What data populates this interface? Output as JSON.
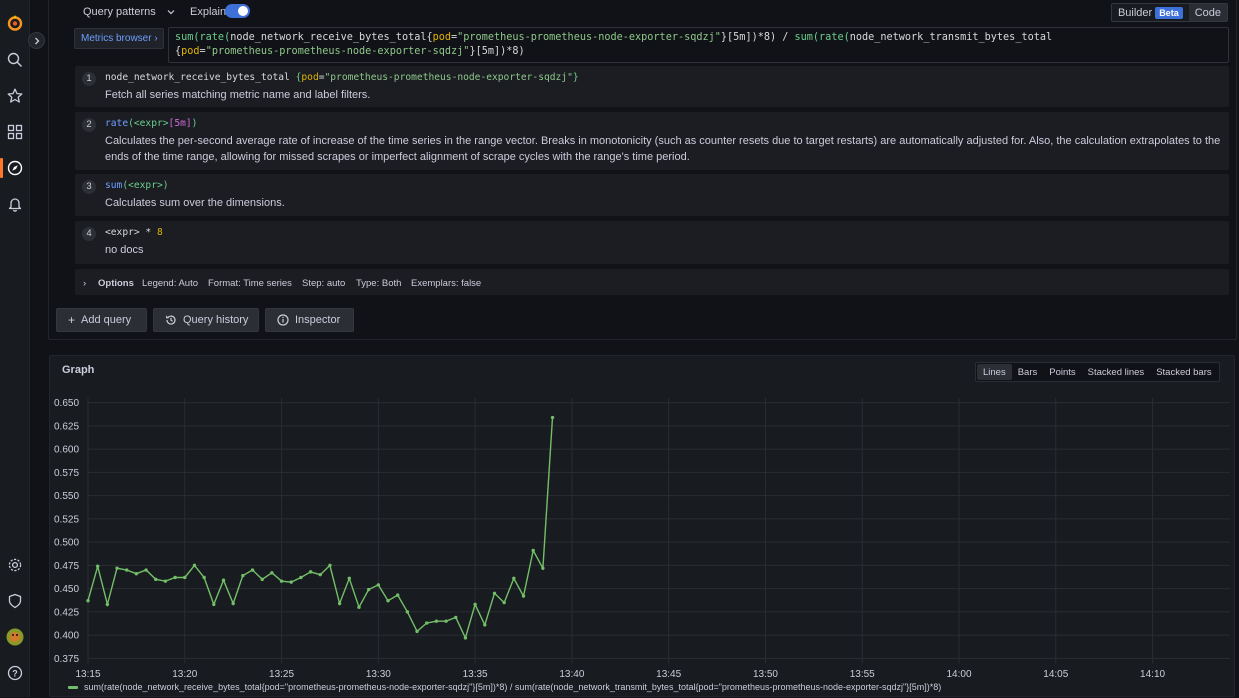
{
  "toolbar": {
    "query_patterns_label": "Query patterns",
    "explain_label": "Explain",
    "explain_enabled": true,
    "builder_label": "Builder",
    "beta_label": "Beta",
    "code_label": "Code"
  },
  "query": {
    "metrics_browser_label": "Metrics browser",
    "line1_fn": "sum(rate(",
    "line1_metric": "node_network_receive_bytes_total{",
    "line1_label": "pod",
    "line1_str": "\"prometheus-prometheus-node-exporter-sqdzj\"",
    "line1_rest": "}[5m])*8) / ",
    "line1_fn2": "sum(rate(",
    "line1_metric2": "node_network_transmit_bytes_total",
    "line2_open": "{",
    "line2_label": "pod",
    "line2_str": "\"prometheus-prometheus-node-exporter-sqdzj\"",
    "line2_rest": "}[5m])*8)"
  },
  "explain_steps": [
    {
      "num": "1",
      "code_a": "node_network_receive_bytes_total ",
      "code_b": "{",
      "code_c": "pod",
      "code_d": "=",
      "code_e": "\"prometheus-prometheus-node-exporter-sqdzj\"",
      "code_f": "}",
      "desc": "Fetch all series matching metric name and label filters."
    },
    {
      "num": "2",
      "code_a": "rate",
      "code_b": "(<expr>",
      "code_c": "[5m]",
      "code_d": ")",
      "desc": "Calculates the per-second average rate of increase of the time series in the range vector. Breaks in monotonicity (such as counter resets due to target restarts) are automatically adjusted for. Also, the calculation extrapolates to the ends of the time range, allowing for missed scrapes or imperfect alignment of scrape cycles with the range's time period."
    },
    {
      "num": "3",
      "code_a": "sum",
      "code_b": "(<expr>)",
      "desc": "Calculates sum over the dimensions."
    },
    {
      "num": "4",
      "code_a": "<expr> * ",
      "code_b": "8",
      "desc": "no docs"
    }
  ],
  "options": {
    "label": "Options",
    "legend": "Legend: Auto",
    "format": "Format: Time series",
    "step": "Step: auto",
    "type": "Type: Both",
    "exemplars": "Exemplars: false"
  },
  "buttons": {
    "add_query": "Add query",
    "query_history": "Query history",
    "inspector": "Inspector"
  },
  "graph": {
    "title": "Graph",
    "view_modes": [
      "Lines",
      "Bars",
      "Points",
      "Stacked lines",
      "Stacked bars"
    ],
    "selected_mode": "Lines",
    "legend_text": "sum(rate(node_network_receive_bytes_total{pod=\"prometheus-prometheus-node-exporter-sqdzj\"}[5m])*8) / sum(rate(node_network_transmit_bytes_total{pod=\"prometheus-prometheus-node-exporter-sqdzj\"}[5m])*8)",
    "series_color": "#73bf69"
  },
  "chart_data": {
    "type": "line",
    "title": "",
    "xlabel": "",
    "ylabel": "",
    "x_ticks": [
      "13:15",
      "13:20",
      "13:25",
      "13:30",
      "13:35",
      "13:40",
      "13:45",
      "13:50",
      "13:55",
      "14:00",
      "14:05",
      "14:10"
    ],
    "x_range": [
      "13:15",
      "14:14"
    ],
    "y_ticks": [
      "0.375",
      "0.400",
      "0.425",
      "0.450",
      "0.475",
      "0.500",
      "0.525",
      "0.550",
      "0.575",
      "0.600",
      "0.625",
      "0.650"
    ],
    "ylim": [
      0.37,
      0.655
    ],
    "grid": true,
    "legend_position": "bottom",
    "series": [
      {
        "name": "sum(rate(node_network_receive_bytes_total{pod=\"prometheus-prometheus-node-exporter-sqdzj\"}[5m])*8) / sum(rate(node_network_transmit_bytes_total{pod=\"prometheus-prometheus-node-exporter-sqdzj\"}[5m])*8)",
        "color": "#73bf69",
        "x": [
          "13:15:00",
          "13:15:30",
          "13:16:00",
          "13:16:30",
          "13:17:00",
          "13:17:30",
          "13:18:00",
          "13:18:30",
          "13:19:00",
          "13:19:30",
          "13:20:00",
          "13:20:30",
          "13:21:00",
          "13:21:30",
          "13:22:00",
          "13:22:30",
          "13:23:00",
          "13:23:30",
          "13:24:00",
          "13:24:30",
          "13:25:00",
          "13:25:30",
          "13:26:00",
          "13:26:30",
          "13:27:00",
          "13:27:30",
          "13:28:00",
          "13:28:30",
          "13:29:00",
          "13:29:30",
          "13:30:00",
          "13:30:30",
          "13:31:00",
          "13:31:30",
          "13:32:00",
          "13:32:30",
          "13:33:00",
          "13:33:30",
          "13:34:00",
          "13:34:30",
          "13:35:00",
          "13:35:30",
          "13:36:00",
          "13:36:30",
          "13:37:00",
          "13:37:30",
          "13:38:00",
          "13:38:30",
          "13:39:00"
        ],
        "values": [
          0.437,
          0.474,
          0.433,
          0.472,
          0.47,
          0.466,
          0.47,
          0.46,
          0.458,
          0.462,
          0.462,
          0.475,
          0.462,
          0.433,
          0.459,
          0.434,
          0.464,
          0.47,
          0.46,
          0.467,
          0.458,
          0.457,
          0.462,
          0.468,
          0.465,
          0.475,
          0.434,
          0.461,
          0.43,
          0.449,
          0.454,
          0.437,
          0.443,
          0.425,
          0.404,
          0.413,
          0.415,
          0.415,
          0.419,
          0.397,
          0.433,
          0.411,
          0.445,
          0.435,
          0.461,
          0.442,
          0.491,
          0.472,
          0.634
        ]
      }
    ]
  }
}
